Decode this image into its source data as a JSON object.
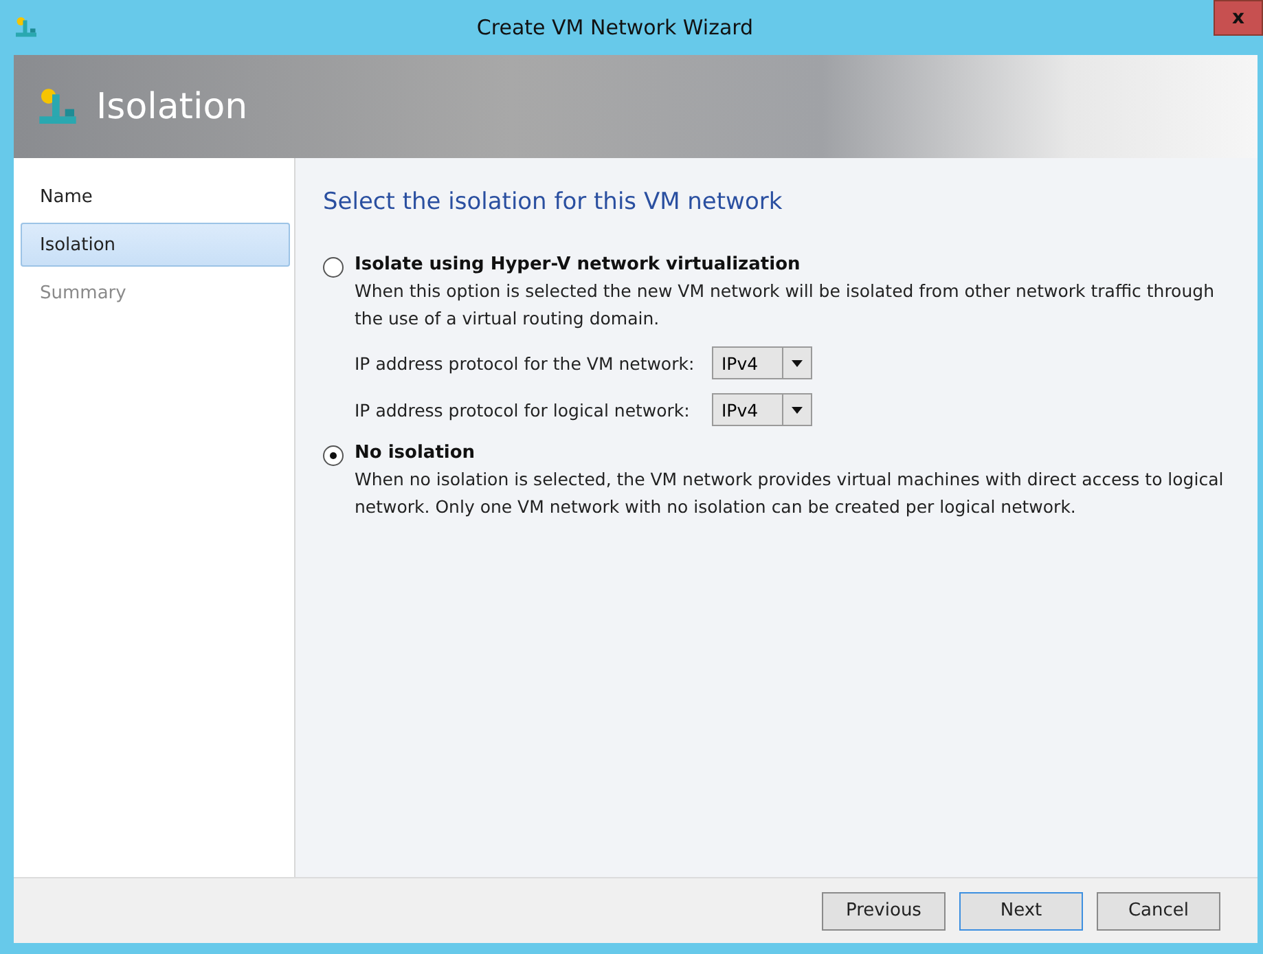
{
  "window": {
    "title": "Create VM Network Wizard",
    "close": "x"
  },
  "header": {
    "title": "Isolation"
  },
  "sidebar": {
    "items": [
      {
        "label": "Name",
        "selected": false,
        "disabled": false
      },
      {
        "label": "Isolation",
        "selected": true,
        "disabled": false
      },
      {
        "label": "Summary",
        "selected": false,
        "disabled": true
      }
    ]
  },
  "content": {
    "heading": "Select the isolation for this VM network",
    "options": [
      {
        "title": "Isolate using Hyper-V network virtualization",
        "selected": false,
        "description": "When this option is selected the new VM network will be isolated from other network traffic through the use of a virtual routing domain.",
        "fields": [
          {
            "label": "IP address protocol for the VM network:",
            "value": "IPv4"
          },
          {
            "label": "IP address protocol for logical network:",
            "value": "IPv4"
          }
        ]
      },
      {
        "title": "No isolation",
        "selected": true,
        "description": "When no isolation is selected, the VM network provides virtual machines with direct access to logical network. Only one VM network with no isolation can be created per logical network."
      }
    ]
  },
  "buttons": [
    {
      "label": "Previous",
      "default": false
    },
    {
      "label": "Next",
      "default": true
    },
    {
      "label": "Cancel",
      "default": false
    }
  ]
}
